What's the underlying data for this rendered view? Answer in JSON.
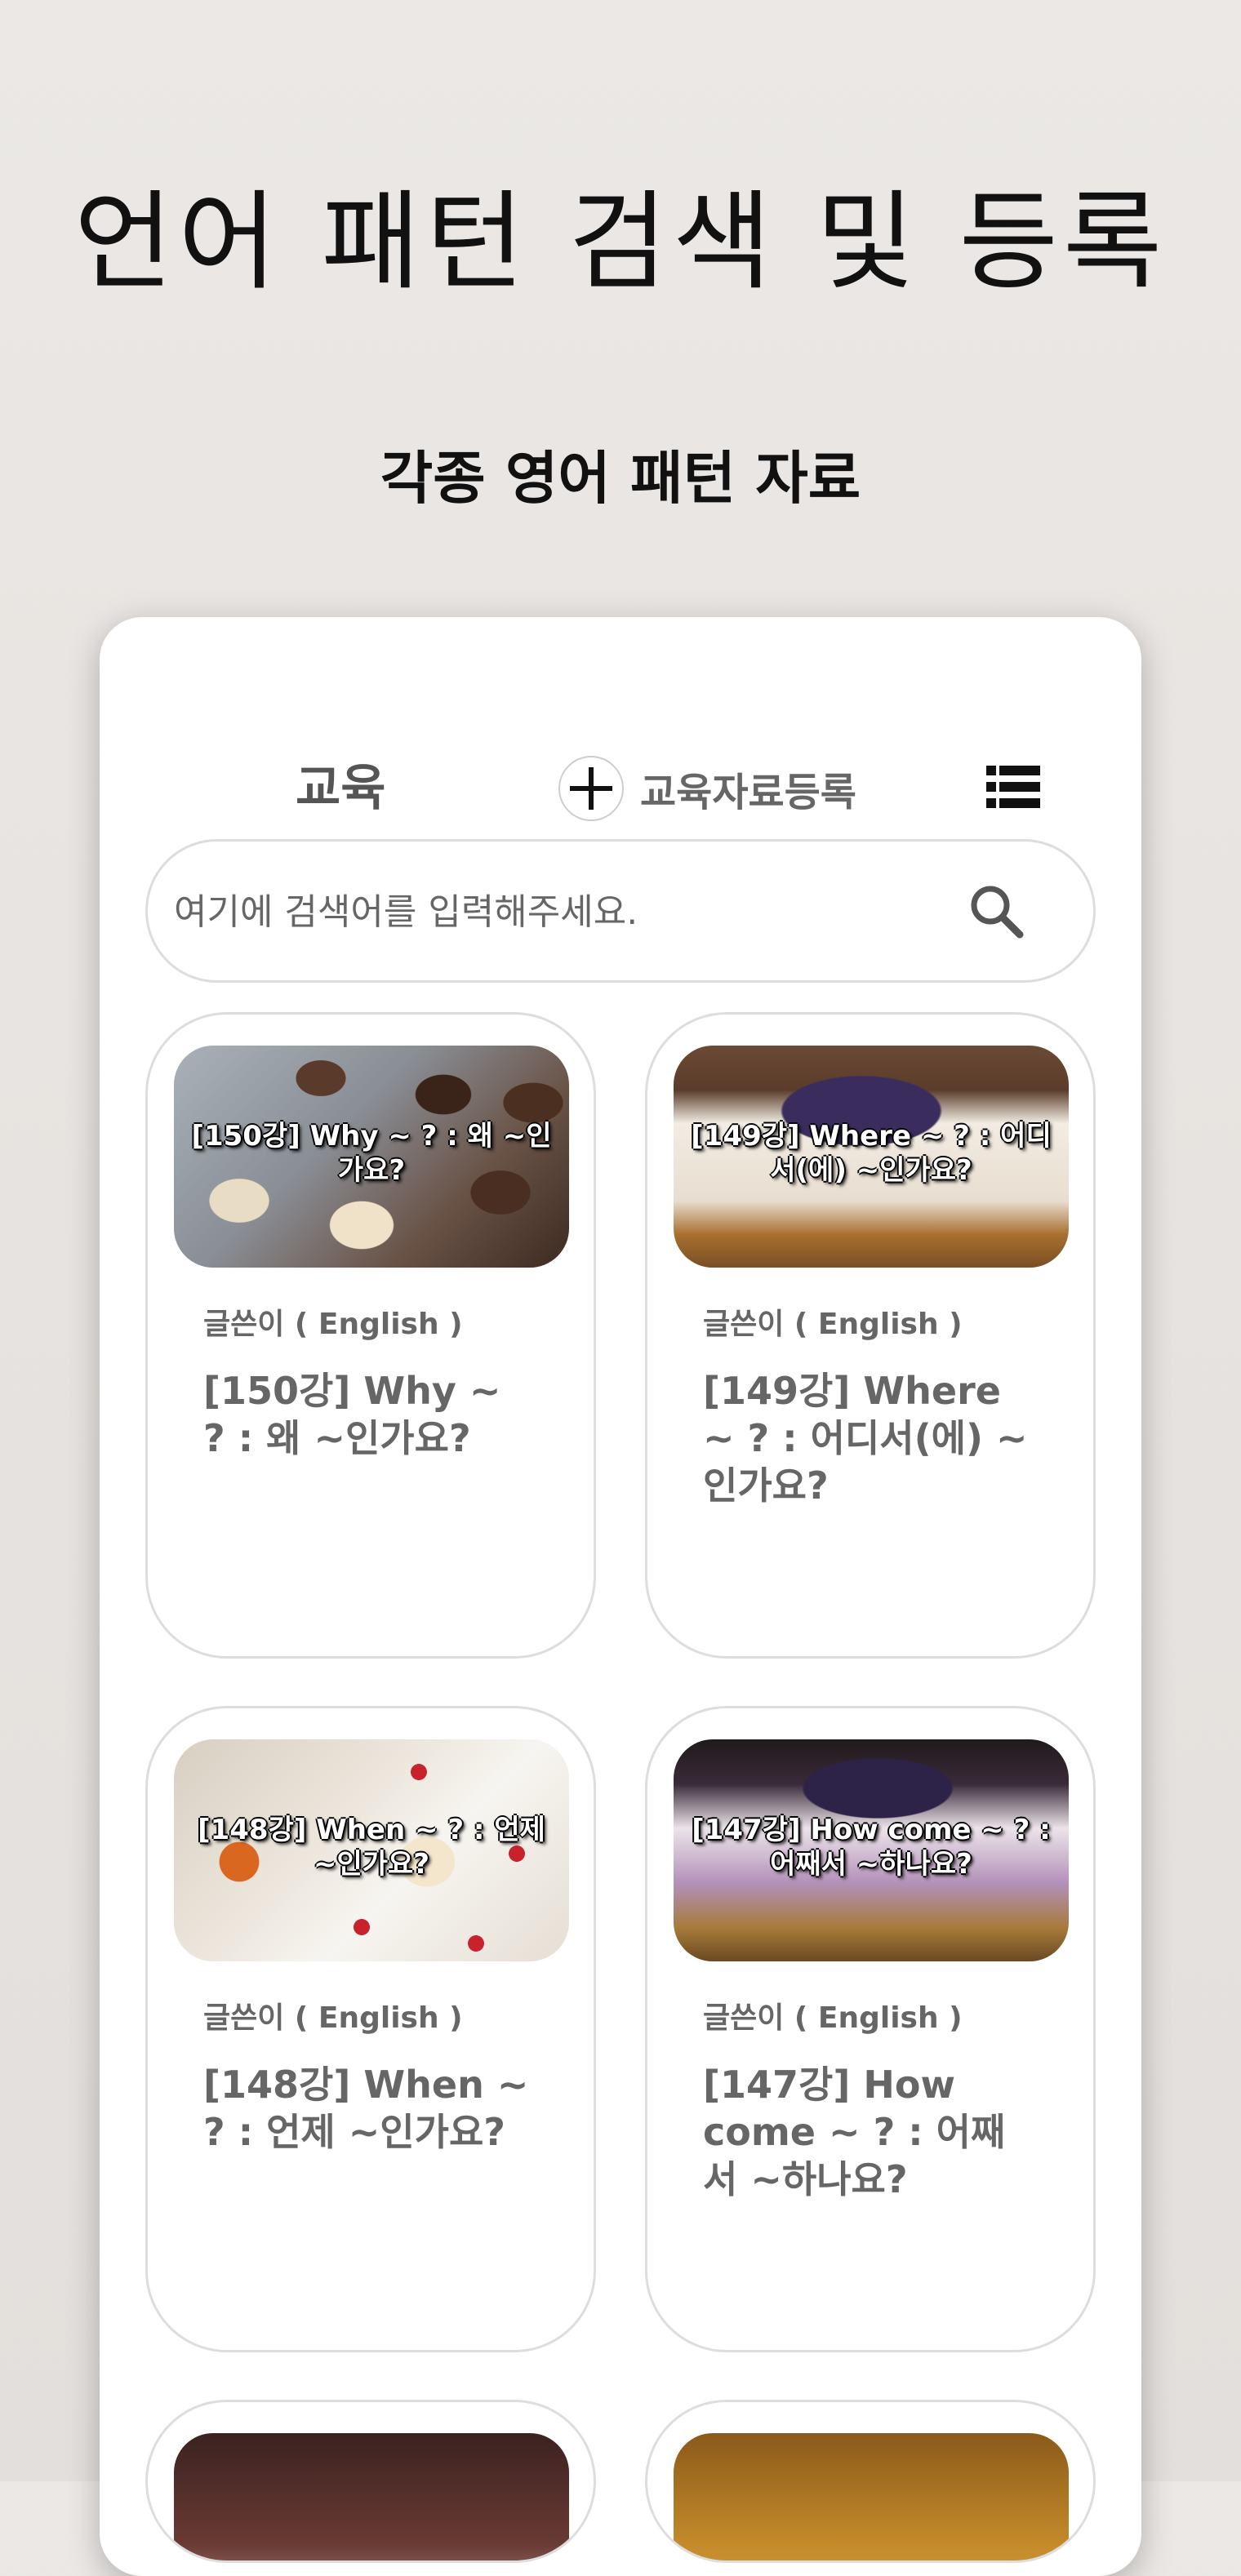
{
  "header": {
    "title": "언어 패턴 검색 및 등록",
    "subtitle": "각종 영어 패턴 자료"
  },
  "tabs": {
    "education_label": "교육",
    "register_label": "교육자료등록",
    "list_icon": "list-icon",
    "register_icon": "plus-icon"
  },
  "search": {
    "placeholder": "여기에 검색어를 입력해주세요.",
    "value": "",
    "icon": "search-icon"
  },
  "cards": [
    {
      "thumb_caption": "[150강] Why ~ ? : 왜 ~인가요?",
      "author": "글쓴이 ( English )",
      "title": "[150강] Why ~ ? : 왜 ~인가요?"
    },
    {
      "thumb_caption": "[149강] Where ~ ? : 어디서(에) ~인가요?",
      "author": "글쓴이 ( English )",
      "title": "[149강] Where ~ ? : 어디서(에) ~인가요?"
    },
    {
      "thumb_caption": "[148강] When ~ ? : 언제 ~인가요?",
      "author": "글쓴이 ( English )",
      "title": "[148강] When ~ ? : 언제 ~인가요?"
    },
    {
      "thumb_caption": "[147강] How come ~ ? : 어째서 ~하나요?",
      "author": "글쓴이 ( English )",
      "title": "[147강] How come ~ ? : 어째서 ~하나요?"
    }
  ],
  "colors": {
    "background": "#e8e5e2",
    "panel": "#ffffff",
    "muted_text": "#666666",
    "border": "#dddddd"
  }
}
